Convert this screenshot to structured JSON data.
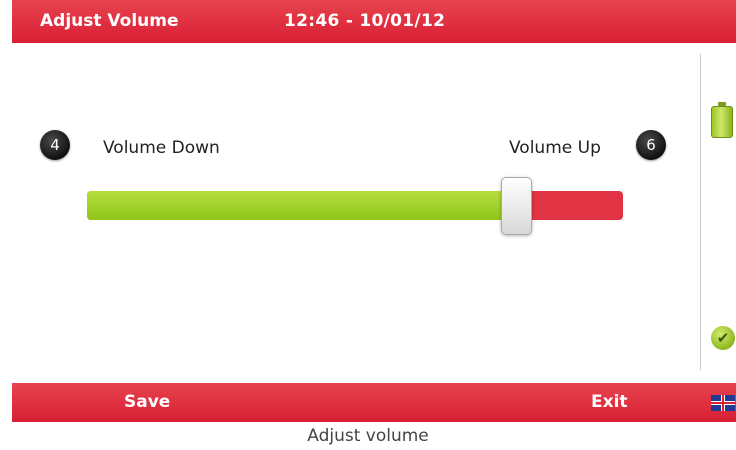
{
  "header": {
    "title": "Adjust Volume",
    "datetime": "12:46 - 10/01/12"
  },
  "volume": {
    "down_key": "4",
    "down_label": "Volume Down",
    "up_key": "6",
    "up_label": "Volume Up",
    "level": 0.8
  },
  "status": {
    "battery_icon": "battery-icon",
    "ok_icon": "check-icon"
  },
  "footer": {
    "left_softkey": "Save",
    "right_softkey": "Exit",
    "language_icon": "uk-flag-icon"
  },
  "caption": "Adjust volume",
  "colors": {
    "bar": "#d81f33",
    "fill": "#8ec61a",
    "track_empty": "#e03344"
  }
}
